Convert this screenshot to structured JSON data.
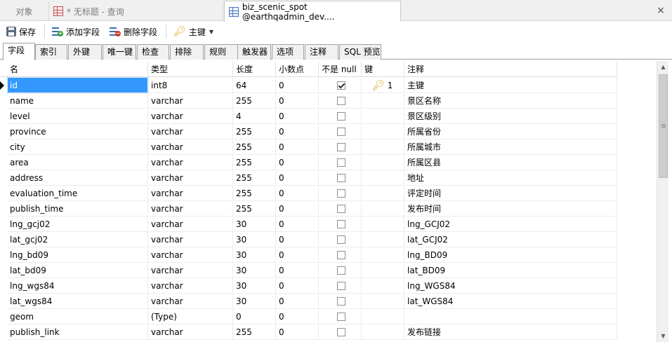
{
  "tabs": [
    {
      "label": "对象"
    },
    {
      "label": "* 无标题 - 查询"
    },
    {
      "label": "biz_scenic_spot @earthqadmin_dev...."
    }
  ],
  "tab_close_label": "×",
  "toolbar": {
    "save_label": "保存",
    "add_field_label": "添加字段",
    "delete_field_label": "删除字段",
    "primary_key_label": "主键"
  },
  "subtabs": [
    "字段",
    "索引",
    "外键",
    "唯一键",
    "检查",
    "排除",
    "规则",
    "触发器",
    "选项",
    "注释",
    "SQL 预览"
  ],
  "columns": [
    "名",
    "类型",
    "长度",
    "小数点",
    "不是 null",
    "键",
    "注释"
  ],
  "rows": [
    {
      "name": "id",
      "type": "int8",
      "length": "64",
      "decimal": "0",
      "not_null": true,
      "key": "1",
      "comment": "主键"
    },
    {
      "name": "name",
      "type": "varchar",
      "length": "255",
      "decimal": "0",
      "not_null": false,
      "key": "",
      "comment": "景区名称"
    },
    {
      "name": "level",
      "type": "varchar",
      "length": "4",
      "decimal": "0",
      "not_null": false,
      "key": "",
      "comment": "景区级别"
    },
    {
      "name": "province",
      "type": "varchar",
      "length": "255",
      "decimal": "0",
      "not_null": false,
      "key": "",
      "comment": "所属省份"
    },
    {
      "name": "city",
      "type": "varchar",
      "length": "255",
      "decimal": "0",
      "not_null": false,
      "key": "",
      "comment": "所属城市"
    },
    {
      "name": "area",
      "type": "varchar",
      "length": "255",
      "decimal": "0",
      "not_null": false,
      "key": "",
      "comment": "所属区县"
    },
    {
      "name": "address",
      "type": "varchar",
      "length": "255",
      "decimal": "0",
      "not_null": false,
      "key": "",
      "comment": "地址"
    },
    {
      "name": "evaluation_time",
      "type": "varchar",
      "length": "255",
      "decimal": "0",
      "not_null": false,
      "key": "",
      "comment": "评定时间"
    },
    {
      "name": "publish_time",
      "type": "varchar",
      "length": "255",
      "decimal": "0",
      "not_null": false,
      "key": "",
      "comment": "发布时间"
    },
    {
      "name": "lng_gcj02",
      "type": "varchar",
      "length": "30",
      "decimal": "0",
      "not_null": false,
      "key": "",
      "comment": "lng_GCJ02"
    },
    {
      "name": "lat_gcj02",
      "type": "varchar",
      "length": "30",
      "decimal": "0",
      "not_null": false,
      "key": "",
      "comment": "lat_GCJ02"
    },
    {
      "name": "lng_bd09",
      "type": "varchar",
      "length": "30",
      "decimal": "0",
      "not_null": false,
      "key": "",
      "comment": "lng_BD09"
    },
    {
      "name": "lat_bd09",
      "type": "varchar",
      "length": "30",
      "decimal": "0",
      "not_null": false,
      "key": "",
      "comment": "lat_BD09"
    },
    {
      "name": "lng_wgs84",
      "type": "varchar",
      "length": "30",
      "decimal": "0",
      "not_null": false,
      "key": "",
      "comment": "lng_WGS84"
    },
    {
      "name": "lat_wgs84",
      "type": "varchar",
      "length": "30",
      "decimal": "0",
      "not_null": false,
      "key": "",
      "comment": "lat_WGS84"
    },
    {
      "name": "geom",
      "type": "(Type)",
      "length": "0",
      "decimal": "0",
      "not_null": false,
      "key": "",
      "comment": ""
    },
    {
      "name": "publish_link",
      "type": "varchar",
      "length": "255",
      "decimal": "0",
      "not_null": false,
      "key": "",
      "comment": "发布链接"
    }
  ],
  "selected_row": 0,
  "colors": {
    "selection": "#3399ff",
    "key_icon": "#d9a21a"
  },
  "icons": {
    "save": "save-icon",
    "add_field": "add-field-icon",
    "delete_field": "delete-field-icon",
    "primary_key": "key-icon",
    "table": "table-icon",
    "query": "query-icon",
    "close": "close-icon"
  }
}
